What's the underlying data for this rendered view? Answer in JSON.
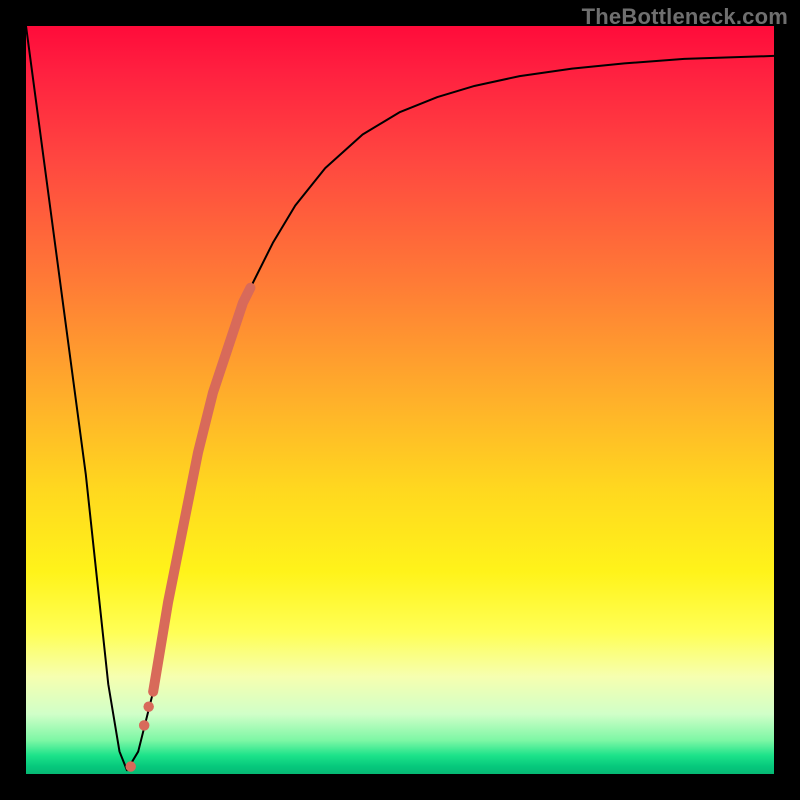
{
  "attribution": "TheBottleneck.com",
  "chart_data": {
    "type": "line",
    "title": "",
    "xlabel": "",
    "ylabel": "",
    "xlim": [
      0,
      100
    ],
    "ylim": [
      0,
      100
    ],
    "curve_points": {
      "x": [
        0,
        4,
        8,
        11,
        12.5,
        13.5,
        15,
        17,
        20,
        22,
        24,
        26,
        28,
        30,
        33,
        36,
        40,
        45,
        50,
        55,
        60,
        66,
        73,
        80,
        88,
        100
      ],
      "y": [
        100,
        70,
        40,
        12,
        3,
        0.5,
        3,
        11,
        28,
        38,
        47,
        54,
        60,
        65,
        71,
        76,
        81,
        85.5,
        88.5,
        90.5,
        92,
        93.3,
        94.3,
        95,
        95.6,
        96
      ]
    },
    "scatter_segment": {
      "description": "Dense salmon-colored points along the rising edge of the curve",
      "x": [
        17,
        18,
        19,
        20,
        21,
        22,
        23,
        24,
        25,
        26,
        27,
        28,
        29,
        30
      ],
      "y": [
        11,
        17,
        23,
        28,
        33,
        38,
        43,
        47,
        51,
        54,
        57,
        60,
        63,
        65
      ]
    },
    "scatter_sparse": {
      "description": "A few isolated salmon points near the minimum",
      "x": [
        15.8,
        16.4,
        14.0
      ],
      "y": [
        6.5,
        9.0,
        1.0
      ]
    },
    "colors": {
      "curve": "#000000",
      "points": "#d86a5a",
      "gradient_top": "#ff0b3a",
      "gradient_bottom": "#06b874"
    }
  }
}
